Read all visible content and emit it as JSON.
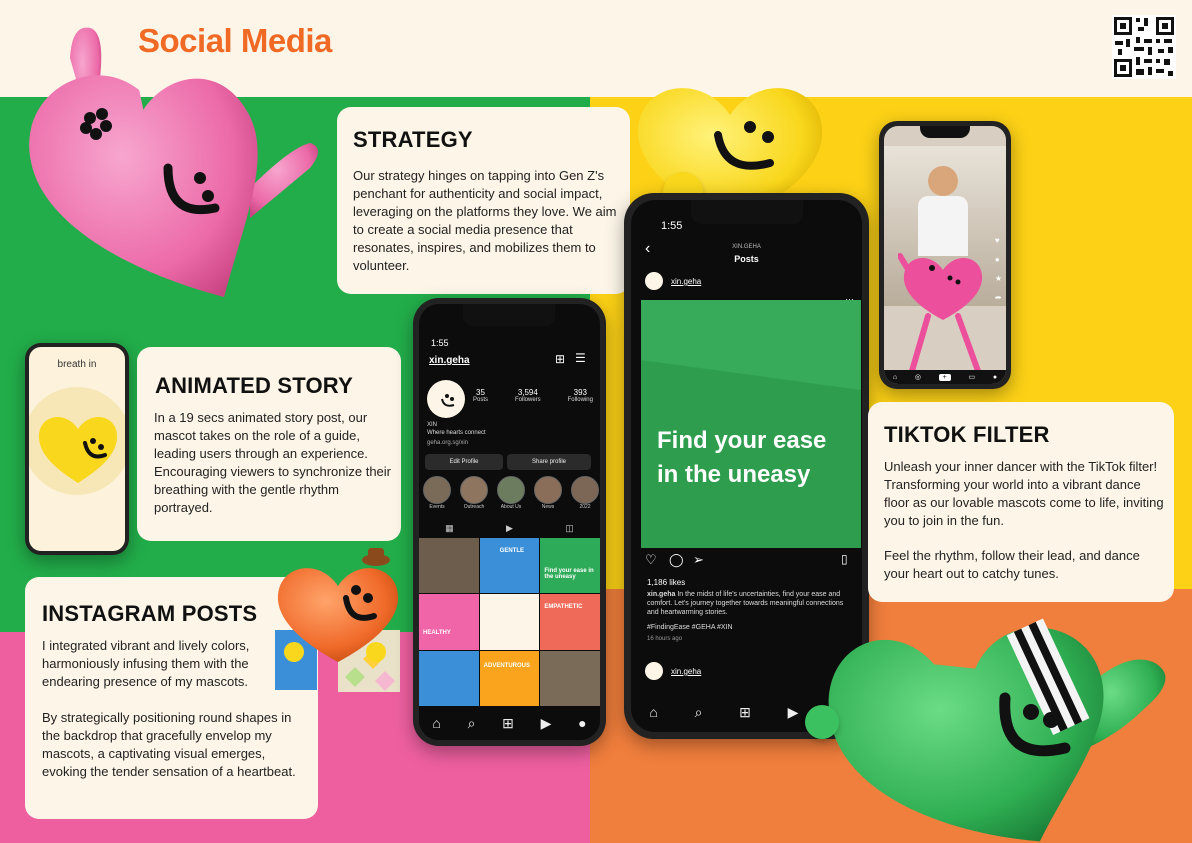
{
  "page": {
    "title": "Social Media"
  },
  "strategy": {
    "heading": "STRATEGY",
    "body": "Our strategy hinges on tapping into Gen Z's penchant for authenticity and social impact, leveraging on the platforms they love. We aim to create a social media presence that resonates, inspires, and mobilizes them to volunteer."
  },
  "animated_story": {
    "heading": "ANIMATED STORY",
    "body": "In a 19 secs animated story post, our mascot takes on the role of a guide, leading users through an experience. Encouraging viewers to synchronize their breathing with the gentle rhythm portrayed.",
    "phone_label": "breath in"
  },
  "instagram_posts": {
    "heading": "INSTAGRAM POSTS",
    "body1": "I integrated vibrant and lively colors, harmoniously infusing them with the endearing presence of my mascots.",
    "body2": "By strategically positioning round shapes in the backdrop that gracefully envelop my mascots, a captivating visual emerges, evoking the tender sensation of a heartbeat."
  },
  "tiktok": {
    "heading": "TIKTOK FILTER",
    "body1": "Unleash your inner dancer with the TikTok filter! Transforming your world into a vibrant dance floor as our lovable mascots come to life, inviting you to join in the fun.",
    "body2": "Feel the rhythm, follow their lead, and dance your heart out to catchy tunes."
  },
  "profile_phone": {
    "time": "1:55",
    "username": "xin.geha",
    "stats": [
      {
        "value": "35",
        "label": "Posts"
      },
      {
        "value": "3,594",
        "label": "Followers"
      },
      {
        "value": "393",
        "label": "Following"
      }
    ],
    "bio_name": "XIN",
    "bio_line": "Where hearts connect",
    "link": "geha.org.sg/xin",
    "edit_button": "Edit Profile",
    "share_button": "Share profile",
    "highlights": [
      "Events",
      "Outreach",
      "About Us",
      "News",
      "2022"
    ],
    "grid_labels": [
      "GENTLE",
      "Find your ease in the uneasy",
      "HEALTHY",
      "EMPATHETIC",
      "ADVENTUROUS"
    ]
  },
  "post_phone": {
    "time": "1:55",
    "header_user": "XIN.GEHA",
    "header_title": "Posts",
    "username": "xin.geha",
    "post_text": "Find your ease in the uneasy",
    "likes": "1,186 likes",
    "caption_user": "xin.geha",
    "caption": "In the midst of life's uncertainties, find your ease and comfort. Let's journey together towards meaningful connections and heartwarming stories.",
    "hashtags": "#FindingEase #GEHA #XIN",
    "time_ago": "16 hours ago",
    "next_user": "xin.geha"
  },
  "colors": {
    "green": "#22ad4a",
    "yellow": "#fcd116",
    "pink": "#ee5fa0",
    "orange": "#f07e3c",
    "title_orange": "#f06a25",
    "cream": "#fdf6e8"
  }
}
